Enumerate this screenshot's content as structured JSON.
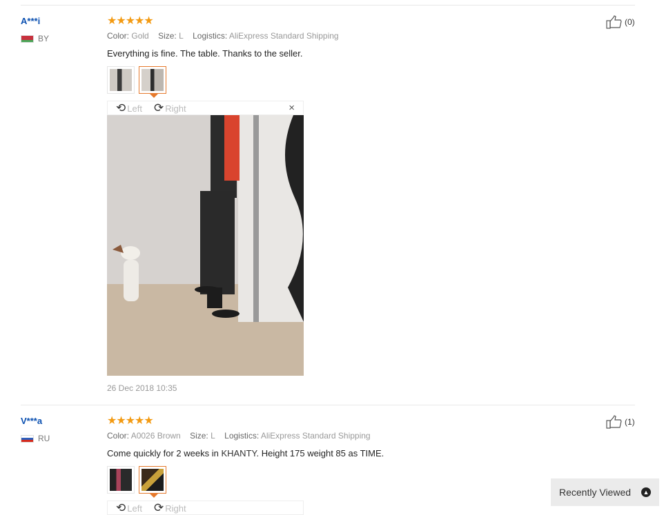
{
  "reviews": [
    {
      "user": "A***i",
      "country": "BY",
      "stars": "★★★★★",
      "color_label": "Color:",
      "color_value": "Gold",
      "size_label": "Size:",
      "size_value": "L",
      "logistics_label": "Logistics:",
      "logistics_value": "AliExpress Standard Shipping",
      "text": "Everything is fine. The table. Thanks to the seller.",
      "likes": "(0)",
      "date": "26 Dec 2018 10:35",
      "viewer": {
        "left_label": "Left",
        "right_label": "Right",
        "close": "×"
      }
    },
    {
      "user": "V***a",
      "country": "RU",
      "stars": "★★★★★",
      "color_label": "Color:",
      "color_value": "A0026 Brown",
      "size_label": "Size:",
      "size_value": "L",
      "logistics_label": "Logistics:",
      "logistics_value": "AliExpress Standard Shipping",
      "text_before": "Come quickly for 2 weeks in ",
      "text_highlight": "KHANTY",
      "text_after": ". Height 175 weight 85 as TIME.",
      "likes": "(1)",
      "viewer": {
        "left_label": "Left",
        "right_label": "Right"
      }
    }
  ],
  "recently_viewed": {
    "label": "Recently Viewed"
  },
  "colors": {
    "user_link": "#0a4fb0",
    "star": "#f39a12",
    "active_thumb": "#e6792c"
  }
}
